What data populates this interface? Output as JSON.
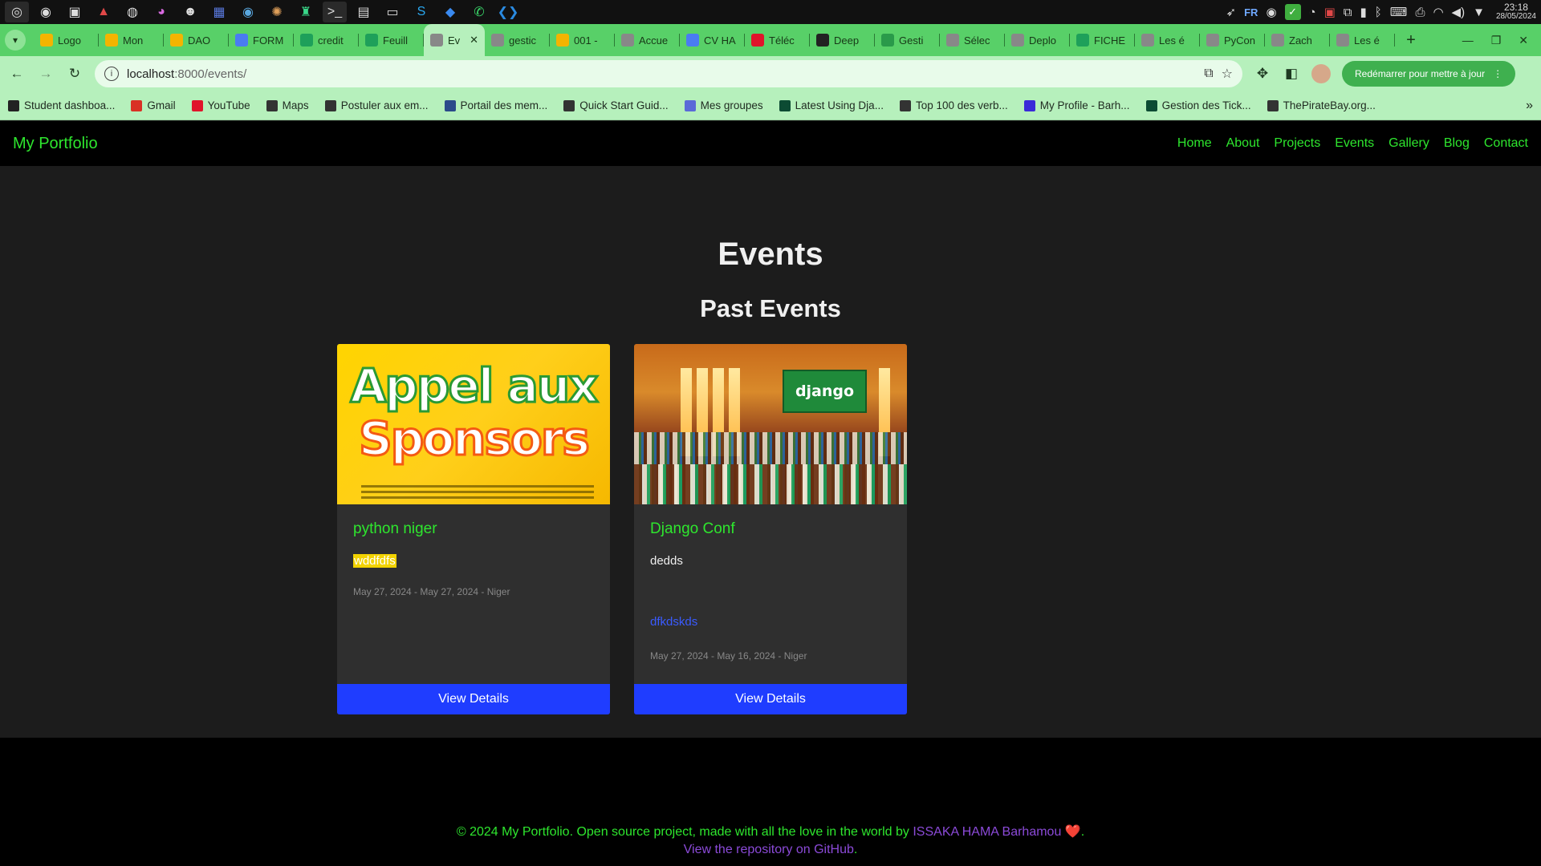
{
  "taskbar": {
    "apps": [
      "app-icon",
      "chrome-icon",
      "app-icon",
      "app-icon",
      "app-icon",
      "app-icon",
      "app-icon",
      "app-icon",
      "app-icon",
      "app-icon",
      "app-icon",
      "terminal-icon",
      "app-icon",
      "app-icon",
      "skype-icon",
      "app-icon",
      "whatsapp-icon",
      "vscode-icon"
    ],
    "lang": "FR",
    "time": "23:18",
    "date": "28/05/2024"
  },
  "browser": {
    "tabs": [
      {
        "label": "Logo",
        "color": "#f4b400"
      },
      {
        "label": "Mon",
        "color": "#f4b400"
      },
      {
        "label": "DAO",
        "color": "#f4b400"
      },
      {
        "label": "FORM",
        "color": "#4a7bf2"
      },
      {
        "label": "credit",
        "color": "#1ea05a"
      },
      {
        "label": "Feuill",
        "color": "#1ea05a"
      },
      {
        "label": "Ev",
        "color": "#888888",
        "active": true
      },
      {
        "label": "gestic",
        "color": "#888888"
      },
      {
        "label": "001 -",
        "color": "#f4b400"
      },
      {
        "label": "Accue",
        "color": "#888888"
      },
      {
        "label": "CV HA",
        "color": "#4a7bf2"
      },
      {
        "label": "Téléc",
        "color": "#e0142b"
      },
      {
        "label": "Deep",
        "color": "#222222"
      },
      {
        "label": "Gesti",
        "color": "#2a9a4a"
      },
      {
        "label": "Sélec",
        "color": "#888888"
      },
      {
        "label": "Deplo",
        "color": "#888888"
      },
      {
        "label": "FICHE",
        "color": "#1ea05a"
      },
      {
        "label": "Les é",
        "color": "#888888"
      },
      {
        "label": "PyCon",
        "color": "#888888"
      },
      {
        "label": "Zach",
        "color": "#888888"
      },
      {
        "label": "Les é",
        "color": "#888888"
      }
    ],
    "url_host": "localhost",
    "url_path": ":8000/events/",
    "update_label": "Redémarrer pour mettre à jour",
    "bookmarks": [
      {
        "label": "Student dashboa...",
        "color": "#222222"
      },
      {
        "label": "Gmail",
        "color": "#d93025"
      },
      {
        "label": "YouTube",
        "color": "#e0142b"
      },
      {
        "label": "Maps",
        "color": "#333333"
      },
      {
        "label": "Postuler aux em...",
        "color": "#333333"
      },
      {
        "label": "Portail des mem...",
        "color": "#2a4a8a"
      },
      {
        "label": "Quick Start Guid...",
        "color": "#333333"
      },
      {
        "label": "Mes groupes",
        "color": "#5a6ad8"
      },
      {
        "label": "Latest Using Dja...",
        "color": "#0c4b33"
      },
      {
        "label": "Top 100 des verb...",
        "color": "#333333"
      },
      {
        "label": "My Profile - Barh...",
        "color": "#3a2ad8"
      },
      {
        "label": "Gestion des Tick...",
        "color": "#0c4b33"
      },
      {
        "label": "ThePirateBay.org...",
        "color": "#333333"
      }
    ]
  },
  "site": {
    "brand": "My Portfolio",
    "nav": [
      "Home",
      "About",
      "Projects",
      "Events",
      "Gallery",
      "Blog",
      "Contact"
    ],
    "heading": "Events",
    "subheading": "Past Events",
    "events": [
      {
        "title": "python niger",
        "description": "wddfdfs",
        "link": "",
        "meta": "May 27, 2024 - May 27, 2024 - Niger",
        "button": "View Details",
        "image_text_1": "Appel aux",
        "image_text_2": "Sponsors"
      },
      {
        "title": "Django Conf",
        "description": "dedds",
        "link": "dfkdskds",
        "meta": "May 27, 2024 - May 16, 2024 - Niger",
        "button": "View Details",
        "image_text_1": "django"
      }
    ],
    "footer": {
      "line1": "© 2024 My Portfolio. Open source project, made with all the love in the world by",
      "author": "ISSAKA HAMA Barhamou",
      "heart": "❤️",
      "line2": "View the repository on GitHub"
    }
  }
}
